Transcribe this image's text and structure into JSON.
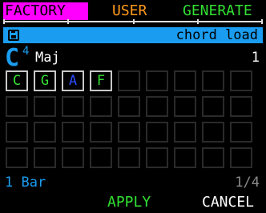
{
  "tabs": {
    "factory": "FACTORY",
    "user": "USER",
    "generate": "GENERATE"
  },
  "header_bar": {
    "label": "chord load",
    "icon": "disk-icon"
  },
  "chord": {
    "root": "C",
    "octave": "4",
    "quality": "Maj",
    "count": "1"
  },
  "grid": {
    "columns": 9,
    "rows": 4,
    "cells": [
      {
        "text": "C",
        "color": "#33e033"
      },
      {
        "text": "G",
        "color": "#33e033"
      },
      {
        "text": "A",
        "color": "#2a4cff"
      },
      {
        "text": "F",
        "color": "#33e033"
      }
    ]
  },
  "footer": {
    "length": "1 Bar",
    "page": "1/4"
  },
  "buttons": {
    "apply": "APPLY",
    "cancel": "CANCEL"
  },
  "colors": {
    "accent": "#1a9df0",
    "factory": "#ff00ff",
    "user": "#ff9a1a",
    "generate": "#33e033"
  }
}
